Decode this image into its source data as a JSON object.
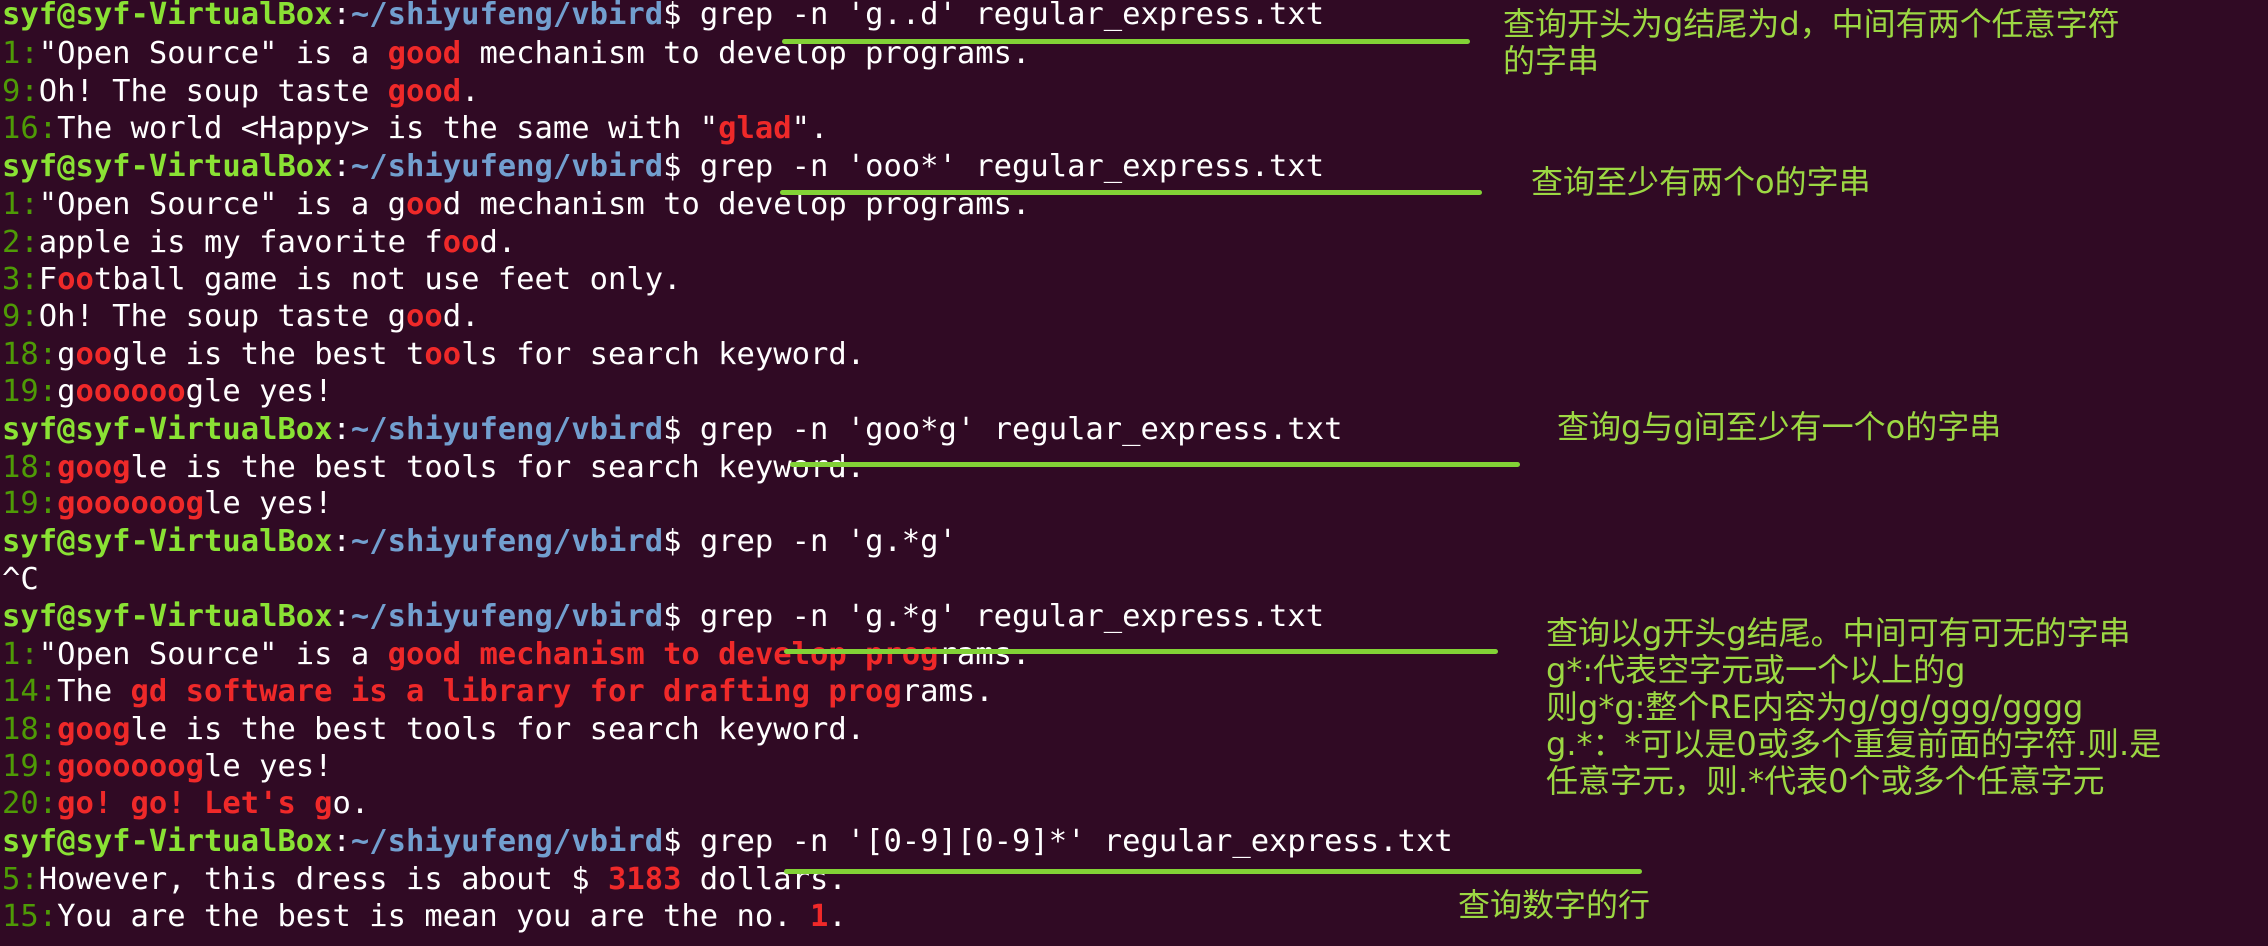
{
  "prompt": {
    "user": "syf@syf-VirtualBox",
    "path": "~/shiyufeng/vbird",
    "symbol": "$",
    "colon": ":"
  },
  "lines": [
    {
      "kind": "cmd",
      "text": "grep -n 'g..d' regular_express.txt"
    },
    {
      "kind": "out",
      "num": "1:",
      "segs": [
        {
          "t": "\"Open Source\" is a "
        },
        {
          "t": "good",
          "m": true
        },
        {
          "t": " mechanism to develop programs."
        }
      ]
    },
    {
      "kind": "out",
      "num": "9:",
      "segs": [
        {
          "t": "Oh! The soup taste "
        },
        {
          "t": "good",
          "m": true
        },
        {
          "t": "."
        }
      ]
    },
    {
      "kind": "out",
      "num": "16:",
      "segs": [
        {
          "t": "The world <Happy> is the same with \""
        },
        {
          "t": "glad",
          "m": true
        },
        {
          "t": "\"."
        }
      ]
    },
    {
      "kind": "cmd",
      "text": "grep -n 'ooo*' regular_express.txt"
    },
    {
      "kind": "out",
      "num": "1:",
      "segs": [
        {
          "t": "\"Open Source\" is a g"
        },
        {
          "t": "oo",
          "m": true
        },
        {
          "t": "d mechanism to develop programs."
        }
      ]
    },
    {
      "kind": "out",
      "num": "2:",
      "segs": [
        {
          "t": "apple is my favorite f"
        },
        {
          "t": "oo",
          "m": true
        },
        {
          "t": "d."
        }
      ]
    },
    {
      "kind": "out",
      "num": "3:",
      "segs": [
        {
          "t": "F"
        },
        {
          "t": "oo",
          "m": true
        },
        {
          "t": "tball game is not use feet only."
        }
      ]
    },
    {
      "kind": "out",
      "num": "9:",
      "segs": [
        {
          "t": "Oh! The soup taste g"
        },
        {
          "t": "oo",
          "m": true
        },
        {
          "t": "d."
        }
      ]
    },
    {
      "kind": "out",
      "num": "18:",
      "segs": [
        {
          "t": "g"
        },
        {
          "t": "oo",
          "m": true
        },
        {
          "t": "gle is the best t"
        },
        {
          "t": "oo",
          "m": true
        },
        {
          "t": "ls for search keyword."
        }
      ]
    },
    {
      "kind": "out",
      "num": "19:",
      "segs": [
        {
          "t": "g"
        },
        {
          "t": "oooooo",
          "m": true
        },
        {
          "t": "gle yes!"
        }
      ]
    },
    {
      "kind": "cmd",
      "text": "grep -n 'goo*g' regular_express.txt"
    },
    {
      "kind": "out",
      "num": "18:",
      "segs": [
        {
          "t": "goog",
          "m": true
        },
        {
          "t": "le is the best tools for search keyword."
        }
      ]
    },
    {
      "kind": "out",
      "num": "19:",
      "segs": [
        {
          "t": "goooooog",
          "m": true
        },
        {
          "t": "le yes!"
        }
      ]
    },
    {
      "kind": "cmd",
      "text": "grep -n 'g.*g'"
    },
    {
      "kind": "plain",
      "text": "^C"
    },
    {
      "kind": "cmd",
      "text": "grep -n 'g.*g' regular_express.txt"
    },
    {
      "kind": "out",
      "num": "1:",
      "segs": [
        {
          "t": "\"Open Source\" is a "
        },
        {
          "t": "good mechanism to develop prog",
          "m": true
        },
        {
          "t": "rams."
        }
      ]
    },
    {
      "kind": "out",
      "num": "14:",
      "segs": [
        {
          "t": "The "
        },
        {
          "t": "gd software is a library for drafting prog",
          "m": true
        },
        {
          "t": "rams."
        }
      ]
    },
    {
      "kind": "out",
      "num": "18:",
      "segs": [
        {
          "t": "goog",
          "m": true
        },
        {
          "t": "le is the best tools for search keyword."
        }
      ]
    },
    {
      "kind": "out",
      "num": "19:",
      "segs": [
        {
          "t": "goooooog",
          "m": true
        },
        {
          "t": "le yes!"
        }
      ]
    },
    {
      "kind": "out",
      "num": "20:",
      "segs": [
        {
          "t": "go! go! Let's g",
          "m": true
        },
        {
          "t": "o."
        }
      ]
    },
    {
      "kind": "cmd",
      "text": "grep -n '[0-9][0-9]*' regular_express.txt"
    },
    {
      "kind": "out",
      "num": "5:",
      "segs": [
        {
          "t": "However, this dress is about $ "
        },
        {
          "t": "3183",
          "m": true
        },
        {
          "t": " dollars."
        }
      ]
    },
    {
      "kind": "out",
      "num": "15:",
      "segs": [
        {
          "t": "You are the best is mean you are the no. "
        },
        {
          "t": "1",
          "m": true
        },
        {
          "t": "."
        }
      ]
    }
  ],
  "annotations": [
    {
      "lines": [
        "查询开头为g结尾为d，中间有两个任意字符",
        "的字串"
      ]
    },
    {
      "lines": [
        "查询至少有两个o的字串"
      ]
    },
    {
      "lines": [
        "查询g与g间至少有一个o的字串"
      ]
    },
    {
      "lines": [
        "查询以g开头g结尾。中间可有可无的字串",
        "g*:代表空字元或一个以上的g",
        "则g*g:整个RE内容为g/gg/ggg/gggg",
        "g.*：*可以是0或多个重复前面的字符.则.是",
        "任意字元，则.*代表0个或多个任意字元"
      ]
    },
    {
      "lines": [
        "查询数字的行"
      ]
    }
  ]
}
